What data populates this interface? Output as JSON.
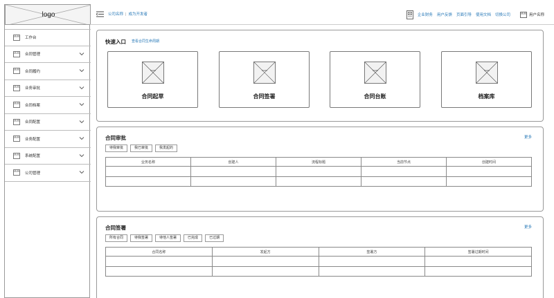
{
  "logo": "logo",
  "sidebar": {
    "items": [
      {
        "label": "工作台",
        "expandable": false
      },
      {
        "label": "合同管理",
        "expandable": true
      },
      {
        "label": "合同履约",
        "expandable": true
      },
      {
        "label": "业务审批",
        "expandable": true
      },
      {
        "label": "合同档案",
        "expandable": true
      },
      {
        "label": "合同配置",
        "expandable": true
      },
      {
        "label": "业务配置",
        "expandable": true
      },
      {
        "label": "系统配置",
        "expandable": true
      },
      {
        "label": "公司管理",
        "expandable": true
      }
    ]
  },
  "topbar": {
    "company_name": "公司名称",
    "separator": "|",
    "become_developer": "成为开发者",
    "links": [
      "企业财务",
      "用户反馈",
      "页面引导",
      "使用文档",
      "切换公司"
    ],
    "user_name": "用户名称"
  },
  "quick_entry": {
    "title": "快速入口",
    "subtitle": "查看合同生命周期",
    "tiles": [
      {
        "icon_text": "icon",
        "label": "合同起草"
      },
      {
        "icon_text": "icon",
        "label": "合同签署"
      },
      {
        "icon_text": "icon",
        "label": "合同台账"
      },
      {
        "icon_text": "icon",
        "label": "档案库"
      }
    ]
  },
  "approval": {
    "title": "合同审批",
    "more": "更多",
    "tabs": [
      "待我审批",
      "我已审批",
      "我发起的"
    ],
    "columns": [
      "业务名称",
      "创建人",
      "流程标题",
      "当前节点",
      "创建时间"
    ],
    "rows": [
      [
        "",
        "",
        "",
        "",
        ""
      ],
      [
        "",
        "",
        "",
        "",
        ""
      ]
    ]
  },
  "signing": {
    "title": "合同签署",
    "more": "更多",
    "tabs": [
      "所有合同",
      "待我签署",
      "待他人签署",
      "已完成",
      "已过期"
    ],
    "columns": [
      "合同名称",
      "发起方",
      "签署方",
      "签署过期时间"
    ],
    "rows": [
      [
        "",
        "",
        "",
        ""
      ],
      [
        "",
        "",
        "",
        ""
      ]
    ]
  },
  "colors": {
    "link": "#2a7ab8",
    "border": "#999999",
    "text": "#333333"
  }
}
